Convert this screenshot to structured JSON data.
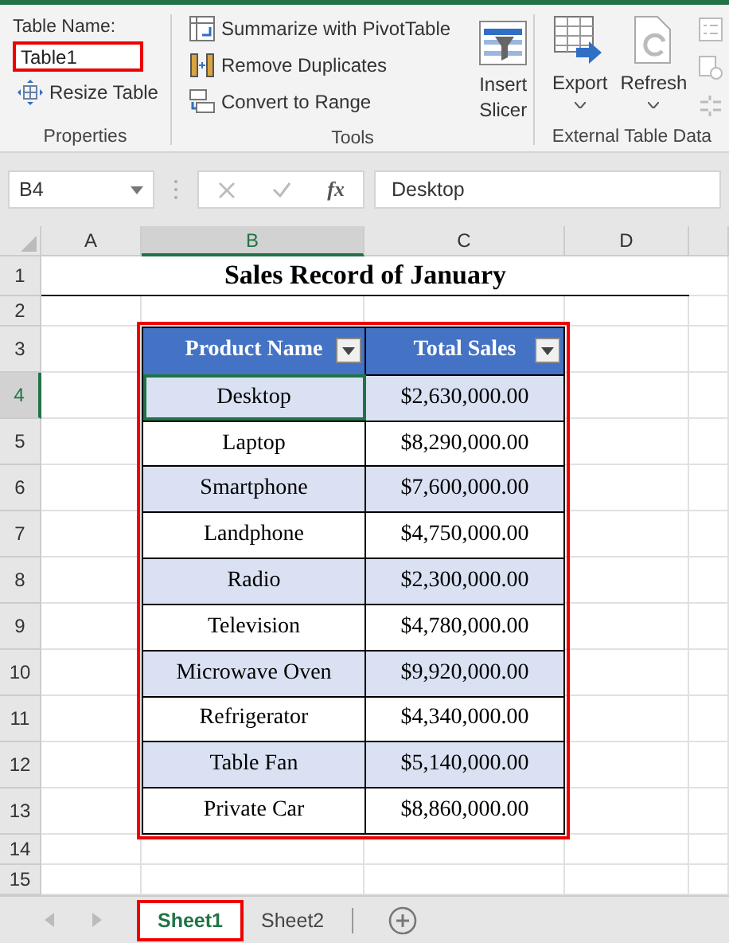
{
  "ribbon": {
    "groups": [
      {
        "label": "Properties"
      },
      {
        "label": "Tools"
      },
      {
        "label": "External Table Data"
      }
    ],
    "table_name": {
      "label": "Table Name:",
      "value": "Table1",
      "highlighted": true
    },
    "resize_button": "Resize Table",
    "tools": [
      "Summarize with PivotTable",
      "Remove Duplicates",
      "Convert to Range"
    ],
    "insert_slicer": [
      "Insert",
      "Slicer"
    ],
    "export": "Export",
    "refresh": "Refresh"
  },
  "formula_bar": {
    "name_box": "B4",
    "function_label": "fx",
    "value": "Desktop"
  },
  "sheet": {
    "columns": [
      {
        "label": "A",
        "selected": false
      },
      {
        "label": "B",
        "selected": true
      },
      {
        "label": "C",
        "selected": false
      },
      {
        "label": "D",
        "selected": false
      }
    ],
    "row_numbers": [
      "1",
      "2",
      "3",
      "4",
      "5",
      "6",
      "7",
      "8",
      "9",
      "10",
      "11",
      "12",
      "13",
      "14",
      "15"
    ],
    "title": "Sales Record of January",
    "table": {
      "highlighted": true,
      "columns": [
        "Product Name",
        "Total Sales"
      ],
      "rows": [
        {
          "product": "Desktop",
          "sales": "$2,630,000.00",
          "selected": true
        },
        {
          "product": "Laptop",
          "sales": "$8,290,000.00",
          "selected": false
        },
        {
          "product": "Smartphone",
          "sales": "$7,600,000.00",
          "selected": false
        },
        {
          "product": "Landphone",
          "sales": "$4,750,000.00",
          "selected": false
        },
        {
          "product": "Radio",
          "sales": "$2,300,000.00",
          "selected": false
        },
        {
          "product": "Television",
          "sales": "$4,780,000.00",
          "selected": false
        },
        {
          "product": "Microwave Oven",
          "sales": "$9,920,000.00",
          "selected": false
        },
        {
          "product": "Refrigerator",
          "sales": "$4,340,000.00",
          "selected": false
        },
        {
          "product": "Table Fan",
          "sales": "$5,140,000.00",
          "selected": false
        },
        {
          "product": "Private Car",
          "sales": "$8,860,000.00",
          "selected": false
        }
      ]
    }
  },
  "sheet_tabs": [
    {
      "label": "Sheet1",
      "selected": true,
      "highlighted": true
    },
    {
      "label": "Sheet2",
      "selected": false,
      "highlighted": false
    }
  ]
}
